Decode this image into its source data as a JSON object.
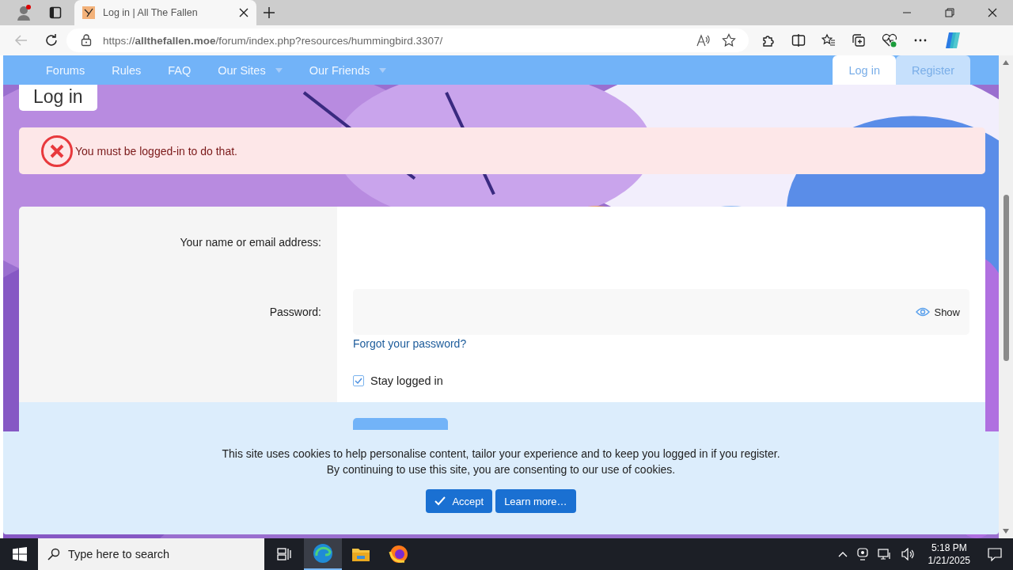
{
  "browser": {
    "tabs": [
      {
        "title": "Log in | All The Fallen",
        "selected": true
      }
    ],
    "url": "https://**allthefallen.moe**/forum/index.php?resources/hummingbird.3307/"
  },
  "nav": {
    "items": [
      {
        "label": "Forums",
        "dropdown": false
      },
      {
        "label": "Rules",
        "dropdown": false
      },
      {
        "label": "FAQ",
        "dropdown": false
      },
      {
        "label": "Our Sites",
        "dropdown": true
      },
      {
        "label": "Our Friends",
        "dropdown": true
      }
    ],
    "account": [
      {
        "label": "Log in",
        "selected": true
      },
      {
        "label": "Register",
        "selected": false
      }
    ]
  },
  "page_title": "Log in",
  "error": "You must be logged-in to do that.",
  "form": {
    "fields": [
      {
        "label": "Your name or email address:",
        "kind": "text"
      },
      {
        "label": "Password:",
        "kind": "password",
        "toggle": "Show"
      }
    ],
    "forgot_link": "Forgot your password?",
    "stay_logged_in": {
      "label": "Stay logged in",
      "checked": true
    }
  },
  "cookie_notice": {
    "lines": [
      "This site uses cookies to help personalise content, tailor your experience and to keep you logged in if you register.",
      "By continuing to use this site, you are consenting to our use of cookies."
    ],
    "buttons": [
      {
        "label": "Accept",
        "kind": "accept"
      },
      {
        "label": "Learn more…",
        "kind": "link"
      }
    ]
  },
  "taskbar": {
    "search_placeholder": "Type here to search",
    "time": "5:18 PM",
    "date": "1/21/2025"
  }
}
